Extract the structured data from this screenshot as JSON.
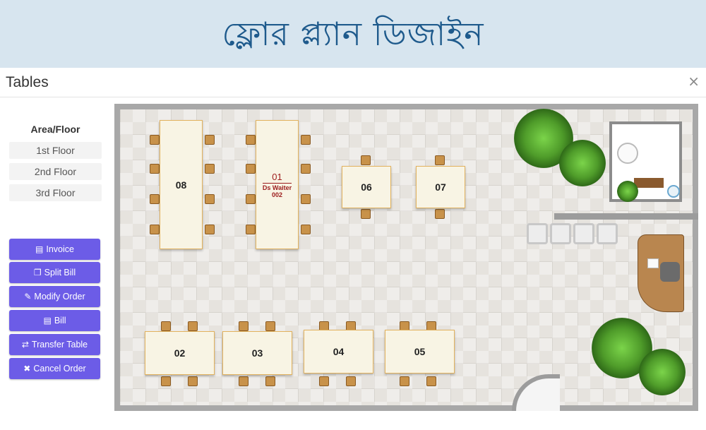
{
  "banner": {
    "title": "ফ্লোর প্ল্যান ডিজাইন"
  },
  "modal": {
    "title": "Tables",
    "close_label": "×"
  },
  "sidebar": {
    "area_heading": "Area/Floor",
    "floors": [
      "1st Floor",
      "2nd Floor",
      "3rd Floor"
    ],
    "actions": [
      {
        "label": "Invoice",
        "icon": "file-icon"
      },
      {
        "label": "Split Bill",
        "icon": "copy-icon"
      },
      {
        "label": "Modify Order",
        "icon": "edit-icon"
      },
      {
        "label": "Bill",
        "icon": "file-icon"
      },
      {
        "label": "Transfer Table",
        "icon": "transfer-icon"
      },
      {
        "label": "Cancel Order",
        "icon": "close-icon"
      }
    ]
  },
  "floor_plan": {
    "tables": [
      {
        "number": "08"
      },
      {
        "number": "01",
        "waiter": "Ds Waiter",
        "code": "002",
        "status": "occupied"
      },
      {
        "number": "06"
      },
      {
        "number": "07"
      },
      {
        "number": "02"
      },
      {
        "number": "03"
      },
      {
        "number": "04"
      },
      {
        "number": "05"
      }
    ]
  },
  "colors": {
    "accent": "#6c5ce7",
    "banner_bg": "#d7e5ef",
    "banner_text": "#1e5a8c",
    "occupied_text": "#a02020"
  }
}
